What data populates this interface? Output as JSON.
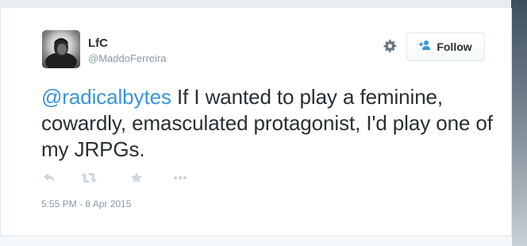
{
  "tweet": {
    "author": {
      "name": "LfC",
      "handle": "@MaddoFerreira"
    },
    "follow_label": "Follow",
    "mention": "@radicalbytes",
    "body": " If I wanted to play a feminine, cowardly, emasculated protagonist, I'd play one of my JRPGs.",
    "timestamp": "5:55 PM - 8 Apr 2015",
    "icons": {
      "settings": "gear-icon",
      "follow": "add-user-icon",
      "reply": "reply-icon",
      "retweet": "retweet-icon",
      "favorite": "star-icon",
      "more": "more-icon"
    }
  },
  "colors": {
    "text": "#292f33",
    "muted": "#8899a6",
    "link": "#3b94d9",
    "action_icon": "#ccd6dd",
    "follow_icon": "#3b94d9"
  }
}
